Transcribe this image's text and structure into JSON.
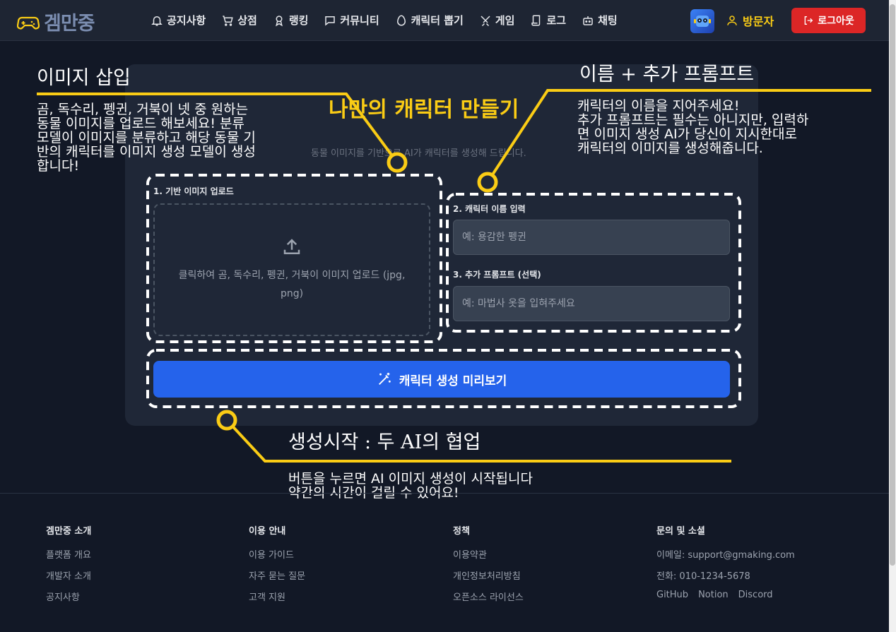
{
  "nav": {
    "logo_text": "겜만중",
    "items": [
      {
        "label": "공지사항",
        "icon": "bell-icon"
      },
      {
        "label": "상점",
        "icon": "cart-icon"
      },
      {
        "label": "랭킹",
        "icon": "medal-icon"
      },
      {
        "label": "커뮤니티",
        "icon": "chat-icon"
      },
      {
        "label": "캐릭터 뽑기",
        "icon": "egg-icon"
      },
      {
        "label": "게임",
        "icon": "swords-icon"
      },
      {
        "label": "로그",
        "icon": "scroll-icon"
      },
      {
        "label": "채팅",
        "icon": "bot-icon"
      }
    ],
    "user_label": "방문자",
    "logout_label": "로그아웃"
  },
  "card": {
    "title": "나만의 캐릭터 만들기",
    "subtitle": "동물 이미지를 기반으로 AI가 캐릭터를 생성해 드립니다.",
    "upload_label": "1. 기반 이미지 업로드",
    "upload_text": "클릭하여 곰, 독수리, 펭귄, 거북이 이미지 업로드 (jpg, png)",
    "name_label": "2. 캐릭터 이름 입력",
    "name_placeholder": "예: 용감한 펭귄",
    "prompt_label": "3. 추가 프롬프트 (선택)",
    "prompt_placeholder": "예: 마법사 옷을 입혀주세요",
    "generate_label": "캐릭터 생성 미리보기"
  },
  "annotations": {
    "upload_title": "이미지 삽입",
    "upload_body": "곰, 독수리, 펭귄, 거북이 넷 중 원하는\n동물 이미지를 업로드 해보세요! 분류\n모델이 이미지를 분류하고 해당 동물 기\n반의 캐릭터를 이미지 생성 모델이 생성\n합니다!",
    "name_title": "이름 + 추가 프롬프트",
    "name_body": "캐릭터의 이름을 지어주세요!\n추가 프롬프트는 필수는 아니지만, 입력하\n면 이미지 생성 AI가 당신이 지시한대로\n캐릭터의 이미지를 생성해줍니다.",
    "generate_title": "생성시작 : 두 AI의 협업",
    "generate_body": "버튼을 누르면 AI 이미지 생성이 시작됩니다\n약간의 시간이 걸릴 수 있어요!",
    "accent_color": "#facc15"
  },
  "footer": {
    "columns": [
      {
        "head": "겜만중 소개",
        "links": [
          "플랫폼 개요",
          "개발자 소개",
          "공지사항"
        ]
      },
      {
        "head": "이용 안내",
        "links": [
          "이용 가이드",
          "자주 묻는 질문",
          "고객 지원"
        ]
      },
      {
        "head": "정책",
        "links": [
          "이용약관",
          "개인정보처리방침",
          "오픈소스 라이선스"
        ]
      },
      {
        "head": "문의 및 소셜",
        "links": [
          "이메일: support@gmaking.com",
          "전화: 010-1234-5678"
        ],
        "social": [
          "GitHub",
          "Notion",
          "Discord"
        ]
      }
    ]
  }
}
